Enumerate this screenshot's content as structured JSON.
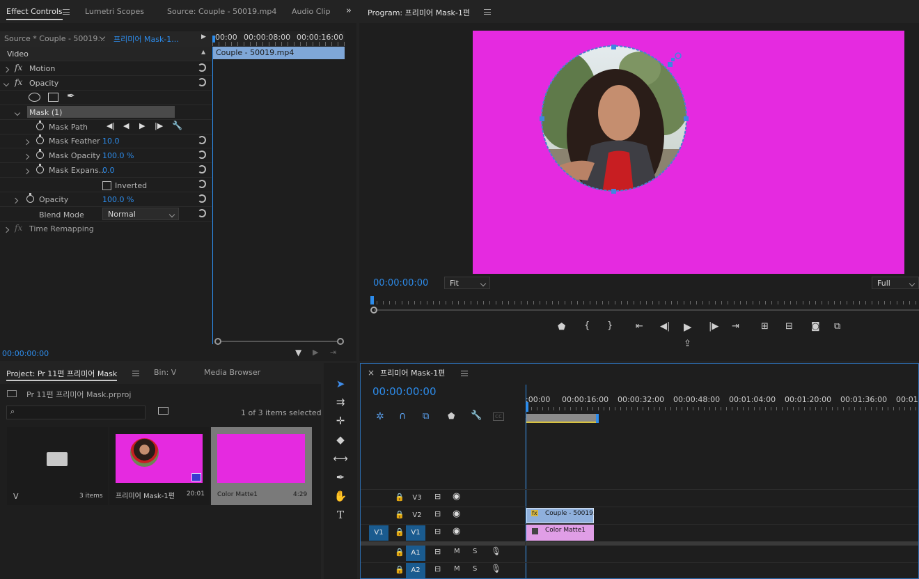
{
  "effect_controls": {
    "tabs": [
      "Effect Controls",
      "Lumetri Scopes",
      "Source: Couple - 50019.mp4",
      "Audio Clip"
    ],
    "source_label": "Source * Couple - 50019...",
    "sequence_label": "프리미어 Mask-1...",
    "timecodes": [
      "00:00",
      "00:00:08:00",
      "00:00:16:00"
    ],
    "clip_name": "Couple - 50019.mp4",
    "video_header": "Video",
    "fx_symbol": "fx",
    "motion": "Motion",
    "opacity": "Opacity",
    "mask": "Mask (1)",
    "mask_path": "Mask Path",
    "mask_feather": "Mask Feather",
    "mask_feather_value": "10.0",
    "mask_opacity": "Mask Opacity",
    "mask_opacity_value": "100.0 %",
    "mask_expansion": "Mask Expans...",
    "mask_expansion_value": "0.0",
    "inverted": "Inverted",
    "opacity_prop": "Opacity",
    "opacity_value": "100.0 %",
    "blend_mode": "Blend Mode",
    "blend_value": "Normal",
    "time_remapping": "Time Remapping",
    "current_time": "00:00:00:00"
  },
  "program": {
    "title": "Program: 프리미어 Mask-1편",
    "timecode": "00:00:00:00",
    "fit": "Fit",
    "full": "Full",
    "frame_color": "#e52ae0"
  },
  "project": {
    "tabs": [
      "Project: Pr 11편 프리미어 Mask",
      "Bin: V",
      "Media Browser"
    ],
    "file": "Pr 11편 프리미어 Mask.prproj",
    "selection": "1 of 3 items selected",
    "items": [
      {
        "name": "V",
        "meta": "3 items"
      },
      {
        "name": "프리미어 Mask-1편",
        "meta": "20:01"
      },
      {
        "name": "Color Matte1",
        "meta": "4:29"
      }
    ]
  },
  "timeline": {
    "title": "프리미어 Mask-1편",
    "close": "×",
    "timecode": "00:00:00:00",
    "ruler": [
      ":00:00",
      "00:00:16:00",
      "00:00:32:00",
      "00:00:48:00",
      "00:01:04:00",
      "00:01:20:00",
      "00:01:36:00",
      "00:01:5"
    ],
    "tracks": [
      {
        "name": "V3",
        "source": ""
      },
      {
        "name": "V2",
        "source": ""
      },
      {
        "name": "V1",
        "source": "V1"
      },
      {
        "name": "A1",
        "source": ""
      },
      {
        "name": "A2",
        "source": ""
      }
    ],
    "track_buttons": {
      "mute": "M",
      "solo": "S"
    },
    "clips": {
      "v2": "Couple - 50019.",
      "v1": "Color Matte1",
      "fx": "fx"
    }
  }
}
